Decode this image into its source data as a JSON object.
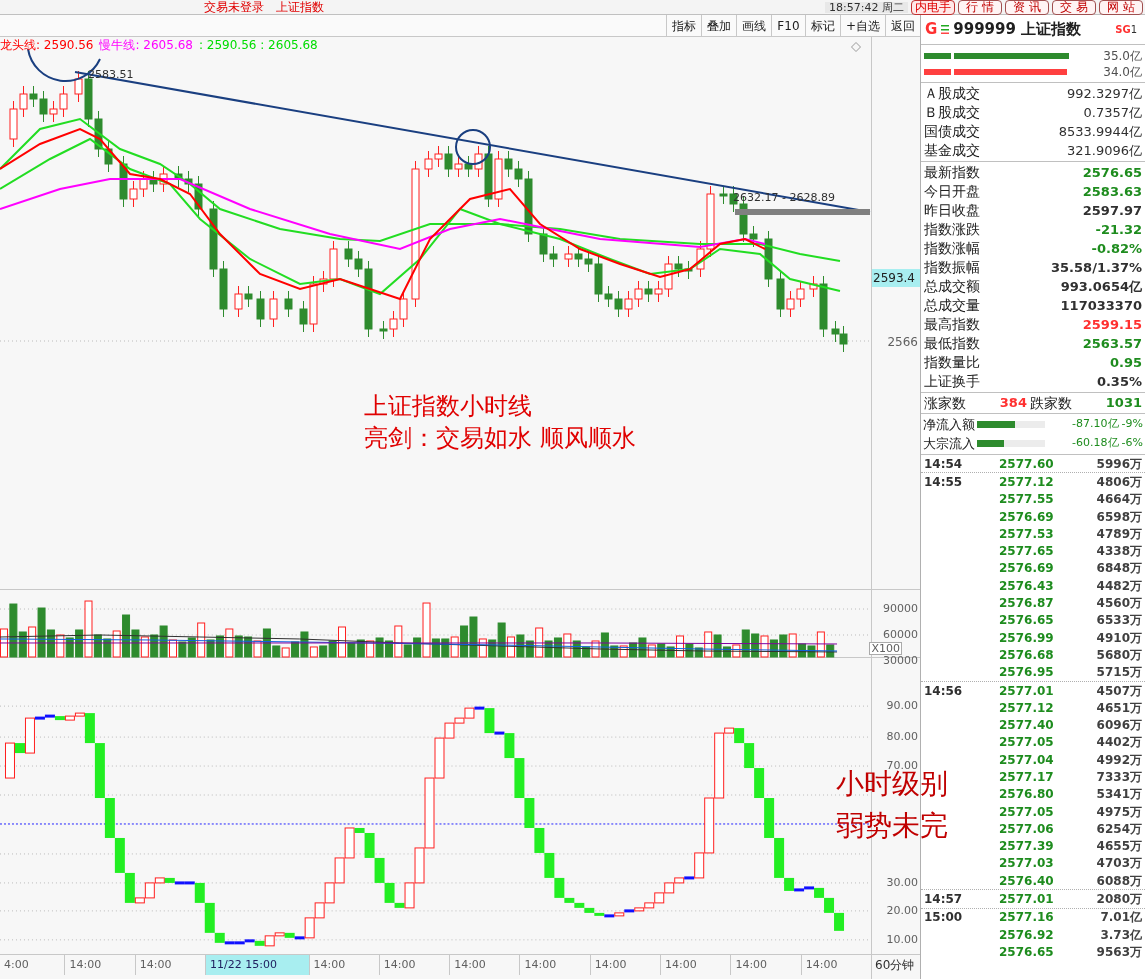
{
  "title_bar": {
    "status": "交易未登录",
    "symbol": "上证指数",
    "clock": "18:57:42 周二",
    "menu": [
      {
        "label": "内电手",
        "selected": true
      },
      {
        "label": "行 情",
        "selected": false
      },
      {
        "label": "资 讯",
        "selected": false
      },
      {
        "label": "交 易",
        "selected": false
      },
      {
        "label": "网 站",
        "selected": false
      }
    ]
  },
  "toolbar": [
    "指标",
    "叠加",
    "画线",
    "F10",
    "标记",
    "+自选",
    "返回"
  ],
  "legend": [
    {
      "text": "龙头线: 2590.56",
      "color": "#ff0000"
    },
    {
      "text": "慢牛线: 2605.68",
      "color": "#ff00ff"
    },
    {
      "text": ": 2590.56 : 2605.68",
      "color": "#00dd00"
    }
  ],
  "price_chart": {
    "peak_label": "2583.51",
    "range_label": "2632.17 - 2628.89",
    "axis": [
      {
        "label": "2593.4",
        "selected": true
      },
      {
        "label": "2566",
        "selected": false
      }
    ],
    "notes": [
      "上证指数小时线",
      "亮剑：交易如水 顺风顺水"
    ]
  },
  "volume_chart": {
    "axis": [
      "90000",
      "60000",
      "30000"
    ],
    "unit": "X100"
  },
  "indicator_chart": {
    "axis": [
      "90.00",
      "80.00",
      "70.00",
      "30.00",
      "20.00",
      "10.00"
    ],
    "notes": [
      "小时级别",
      "弱势未完"
    ]
  },
  "time_axis": [
    {
      "label": "4:00",
      "selected": false
    },
    {
      "label": "14:00",
      "selected": false
    },
    {
      "label": "14:00",
      "selected": false
    },
    {
      "label": "11/22 15:00",
      "selected": true
    },
    {
      "label": "14:00",
      "selected": false
    },
    {
      "label": "14:00",
      "selected": false
    },
    {
      "label": "14:00",
      "selected": false
    },
    {
      "label": "14:00",
      "selected": false
    },
    {
      "label": "14:00",
      "selected": false
    },
    {
      "label": "14:00",
      "selected": false
    },
    {
      "label": "14:00",
      "selected": false
    },
    {
      "label": "14:00",
      "selected": false
    }
  ],
  "period": "60分钟",
  "quote": {
    "flag": "G",
    "code_name": "999999 上证指数",
    "tag": "SG",
    "tag_num": "1",
    "bars": [
      {
        "value": "35.0亿",
        "color": "#2e8b2e"
      },
      {
        "value": "34.0亿",
        "color": "#ff4040"
      }
    ],
    "turnover": [
      {
        "label": "Ａ股成交",
        "value": "992.3297亿"
      },
      {
        "label": "Ｂ股成交",
        "value": "0.7357亿"
      },
      {
        "label": "国债成交",
        "value": "8533.9944亿"
      },
      {
        "label": "基金成交",
        "value": "321.9096亿"
      }
    ],
    "stats": [
      {
        "label": "最新指数",
        "value": "2576.65",
        "color": "#1e8c1e"
      },
      {
        "label": "今日开盘",
        "value": "2583.63",
        "color": "#1e8c1e"
      },
      {
        "label": "昨日收盘",
        "value": "2597.97",
        "color": "#303030"
      },
      {
        "label": "指数涨跌",
        "value": "-21.32",
        "color": "#1e8c1e"
      },
      {
        "label": "指数涨幅",
        "value": "-0.82%",
        "color": "#1e8c1e"
      },
      {
        "label": "指数振幅",
        "value": "35.58/1.37%",
        "color": "#303030"
      },
      {
        "label": "总成交额",
        "value": "993.0654亿",
        "color": "#303030"
      },
      {
        "label": "总成交量",
        "value": "117033370",
        "color": "#303030"
      },
      {
        "label": "最高指数",
        "value": "2599.15",
        "color": "#ff3030"
      },
      {
        "label": "最低指数",
        "value": "2563.57",
        "color": "#1e8c1e"
      },
      {
        "label": "指数量比",
        "value": "0.95",
        "color": "#1e8c1e"
      },
      {
        "label": "上证换手",
        "value": "0.35%",
        "color": "#303030"
      }
    ],
    "breadth": {
      "up_label": "涨家数",
      "up_count": "384",
      "down_label": "跌家数",
      "down_count": "1031"
    },
    "flows": [
      {
        "label": "净流入额",
        "value": "-87.10亿",
        "pct": "-9%",
        "level": 0.56
      },
      {
        "label": "大宗流入",
        "value": "-60.18亿",
        "pct": "-6%",
        "level": 0.39
      }
    ]
  },
  "ticks": [
    {
      "time": "14:54",
      "rows": [
        {
          "price": "2577.60",
          "volume": "5996万"
        }
      ]
    },
    {
      "time": "14:55",
      "rows": [
        {
          "price": "2577.12",
          "volume": "4806万"
        },
        {
          "price": "2577.55",
          "volume": "4664万"
        },
        {
          "price": "2576.69",
          "volume": "6598万"
        },
        {
          "price": "2577.53",
          "volume": "4789万"
        },
        {
          "price": "2577.65",
          "volume": "4338万"
        },
        {
          "price": "2576.69",
          "volume": "6848万"
        },
        {
          "price": "2576.43",
          "volume": "4482万"
        },
        {
          "price": "2576.87",
          "volume": "4560万"
        },
        {
          "price": "2576.65",
          "volume": "6533万"
        },
        {
          "price": "2576.99",
          "volume": "4910万"
        },
        {
          "price": "2576.68",
          "volume": "5680万"
        },
        {
          "price": "2576.95",
          "volume": "5715万"
        }
      ]
    },
    {
      "time": "14:56",
      "rows": [
        {
          "price": "2577.01",
          "volume": "4507万"
        },
        {
          "price": "2577.12",
          "volume": "4651万"
        },
        {
          "price": "2577.40",
          "volume": "6096万"
        },
        {
          "price": "2577.05",
          "volume": "4402万"
        },
        {
          "price": "2577.04",
          "volume": "4992万"
        },
        {
          "price": "2577.17",
          "volume": "7333万"
        },
        {
          "price": "2576.80",
          "volume": "5341万"
        },
        {
          "price": "2577.05",
          "volume": "4975万"
        },
        {
          "price": "2577.06",
          "volume": "6254万"
        },
        {
          "price": "2577.39",
          "volume": "4655万"
        },
        {
          "price": "2577.03",
          "volume": "4703万"
        },
        {
          "price": "2576.40",
          "volume": "6088万"
        }
      ]
    },
    {
      "time": "14:57",
      "rows": [
        {
          "price": "2577.01",
          "volume": "2080万"
        }
      ]
    },
    {
      "time": "15:00",
      "rows": [
        {
          "price": "2577.16",
          "volume": "7.01亿"
        },
        {
          "price": "2576.92",
          "volume": "3.73亿"
        },
        {
          "price": "2576.65",
          "volume": "9563万"
        }
      ]
    }
  ]
}
